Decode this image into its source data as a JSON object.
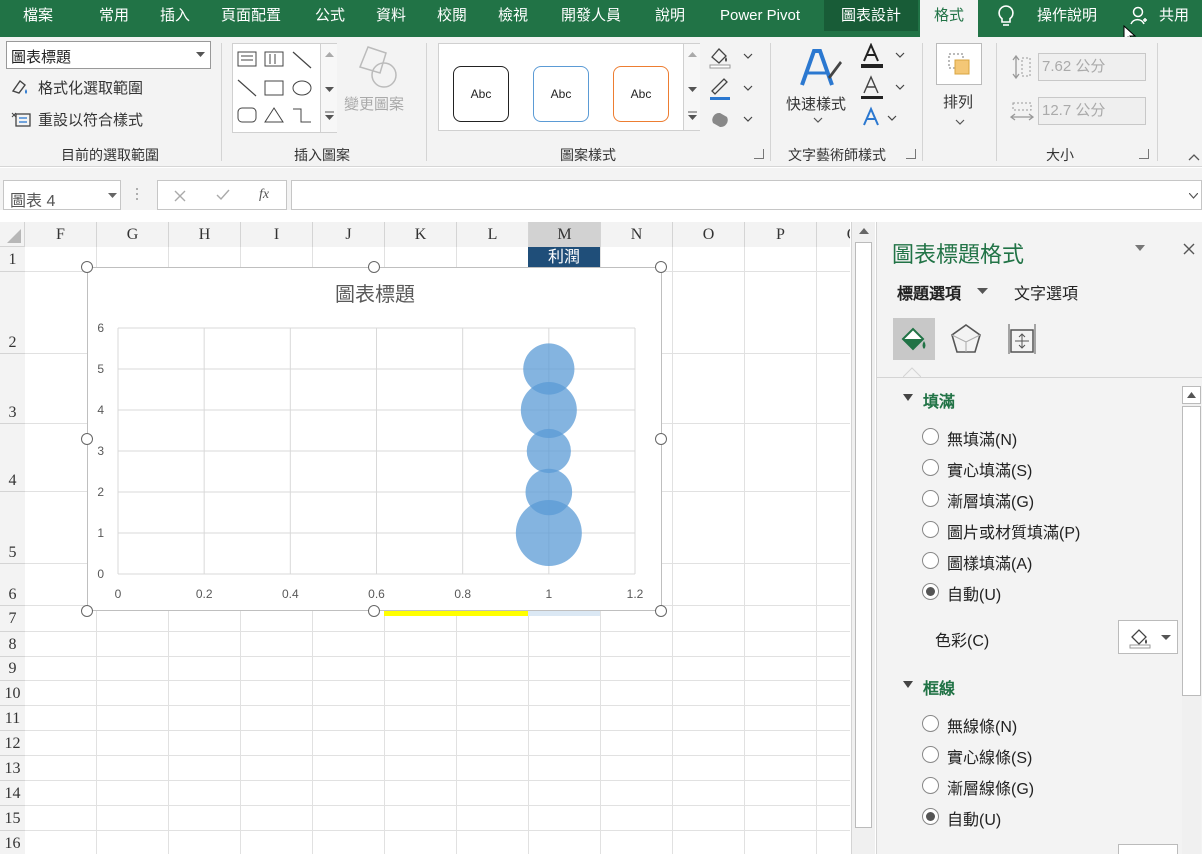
{
  "menu": {
    "items": [
      "檔案",
      "常用",
      "插入",
      "頁面配置",
      "公式",
      "資料",
      "校閱",
      "檢視",
      "開發人員",
      "說明",
      "Power Pivot",
      "圖表設計",
      "格式"
    ],
    "tell_me": "操作說明",
    "share": "共用"
  },
  "ribbon": {
    "selection_box": "圖表標題",
    "format_selection": "格式化選取範圍",
    "reset_style": "重設以符合樣式",
    "group_current": "目前的選取範圍",
    "change_shape": "變更圖案",
    "group_insert_shapes": "插入圖案",
    "abc1": "Abc",
    "abc2": "Abc",
    "abc3": "Abc",
    "group_shape_styles": "圖案樣式",
    "quick_styles": "快速樣式",
    "group_wordart": "文字藝術師樣式",
    "arrange": "排列",
    "height": "7.62 公分",
    "width": "12.7 公分",
    "group_size": "大小"
  },
  "formula_bar": {
    "name_box": "圖表 4",
    "fx": "fx",
    "formula": ""
  },
  "sheet": {
    "columns": [
      "F",
      "G",
      "H",
      "I",
      "J",
      "K",
      "L",
      "M",
      "N",
      "O",
      "P",
      "Q"
    ],
    "rows": [
      "1",
      "2",
      "3",
      "4",
      "5",
      "6",
      "7",
      "8",
      "9",
      "10",
      "11",
      "12",
      "13",
      "14",
      "15",
      "16"
    ],
    "m1_value": "利潤"
  },
  "chart_data": {
    "type": "scatter",
    "title": "圖表標題",
    "xlim": [
      0,
      1.2
    ],
    "ylim": [
      0,
      6
    ],
    "x_ticks": [
      "0",
      "0.2",
      "0.4",
      "0.6",
      "0.8",
      "1",
      "1.2"
    ],
    "y_ticks": [
      "0",
      "1",
      "2",
      "3",
      "4",
      "5",
      "6"
    ],
    "grid": true,
    "bubble_color": "#5b9bd5",
    "points": [
      {
        "x": 1,
        "y": 1,
        "size": 1.0
      },
      {
        "x": 1,
        "y": 2,
        "size": 0.5
      },
      {
        "x": 1,
        "y": 3,
        "size": 0.45
      },
      {
        "x": 1,
        "y": 4,
        "size": 0.72
      },
      {
        "x": 1,
        "y": 5,
        "size": 0.6
      }
    ]
  },
  "pane": {
    "title": "圖表標題格式",
    "tab_title_options": "標題選項",
    "tab_text_options": "文字選項",
    "fill_section": "填滿",
    "fill_options": [
      "無填滿(N)",
      "實心填滿(S)",
      "漸層填滿(G)",
      "圖片或材質填滿(P)",
      "圖樣填滿(A)",
      "自動(U)"
    ],
    "fill_selected": 5,
    "color_label": "色彩(C)",
    "border_section": "框線",
    "border_options": [
      "無線條(N)",
      "實心線條(S)",
      "漸層線條(G)",
      "自動(U)"
    ],
    "border_selected": 3
  }
}
